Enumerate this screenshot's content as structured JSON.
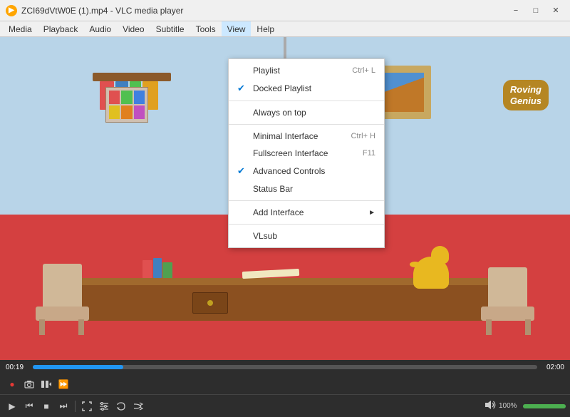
{
  "window": {
    "title": "ZCI69dVtW0E (1).mp4 - VLC media player",
    "icon_label": "▶"
  },
  "menubar": {
    "items": [
      "Media",
      "Playback",
      "Audio",
      "Video",
      "Subtitle",
      "Tools",
      "View",
      "Help"
    ]
  },
  "view_menu": {
    "items": [
      {
        "id": "playlist",
        "label": "Playlist",
        "shortcut": "Ctrl+ L",
        "checked": false,
        "has_arrow": false
      },
      {
        "id": "docked-playlist",
        "label": "Docked Playlist",
        "shortcut": "",
        "checked": true,
        "has_arrow": false
      },
      {
        "id": "separator1",
        "type": "separator"
      },
      {
        "id": "always-on-top",
        "label": "Always on top",
        "shortcut": "",
        "checked": false,
        "has_arrow": false
      },
      {
        "id": "separator2",
        "type": "separator"
      },
      {
        "id": "minimal-interface",
        "label": "Minimal Interface",
        "shortcut": "Ctrl+ H",
        "checked": false,
        "has_arrow": false
      },
      {
        "id": "fullscreen-interface",
        "label": "Fullscreen Interface",
        "shortcut": "F11",
        "checked": false,
        "has_arrow": false
      },
      {
        "id": "advanced-controls",
        "label": "Advanced Controls",
        "shortcut": "",
        "checked": true,
        "has_arrow": false
      },
      {
        "id": "status-bar",
        "label": "Status Bar",
        "shortcut": "",
        "checked": false,
        "has_arrow": false
      },
      {
        "id": "separator3",
        "type": "separator"
      },
      {
        "id": "add-interface",
        "label": "Add Interface",
        "shortcut": "",
        "checked": false,
        "has_arrow": true
      },
      {
        "id": "separator4",
        "type": "separator"
      },
      {
        "id": "vlsub",
        "label": "VLsub",
        "shortcut": "",
        "checked": false,
        "has_arrow": false
      }
    ]
  },
  "player": {
    "time_current": "00:19",
    "time_total": "02:00",
    "volume_pct": "100%",
    "progress_pct": 18
  },
  "logo": {
    "line1": "Roving",
    "line2": "Genius"
  },
  "controls_top": {
    "buttons": [
      "●",
      "📷",
      "⊞",
      "⊳"
    ]
  },
  "controls_bottom": {
    "left_buttons": [
      "▶",
      "⏮",
      "⏹",
      "⏭"
    ],
    "mid_buttons": [
      "⤢",
      "≡",
      "↺",
      "✕"
    ]
  }
}
